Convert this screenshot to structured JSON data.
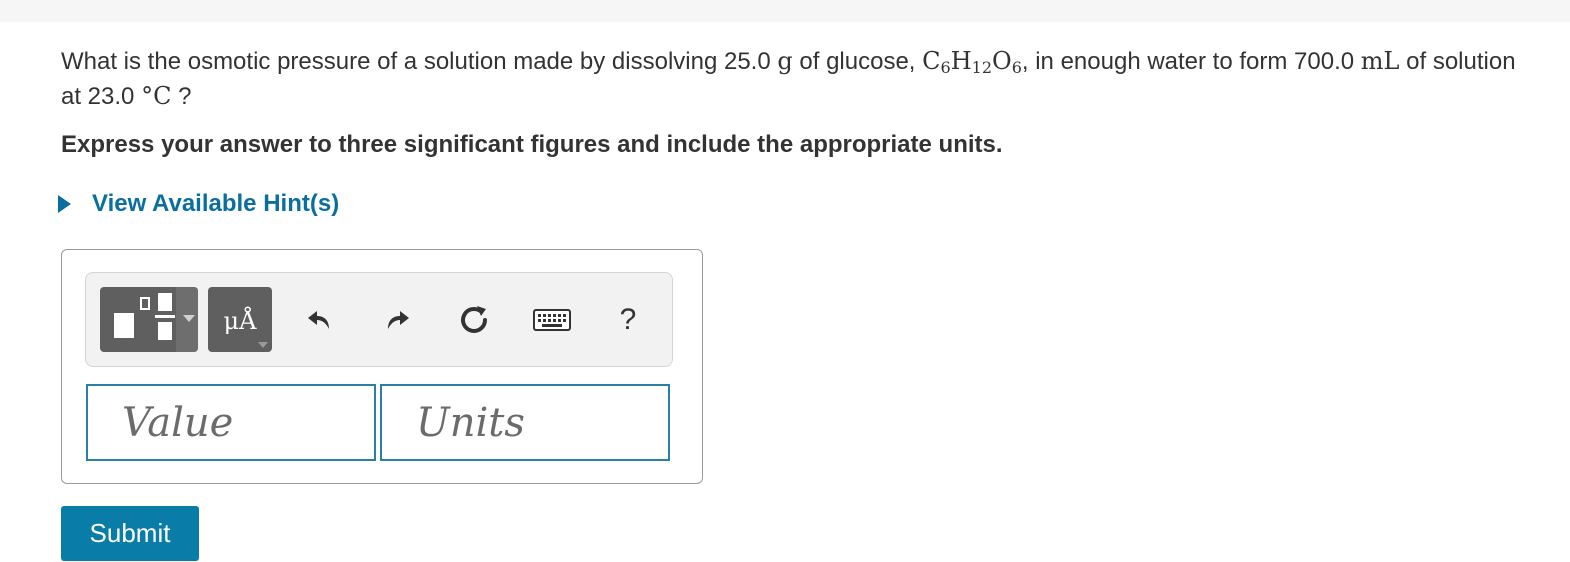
{
  "question": {
    "text_before_mass": "What is the osmotic pressure of a solution made by dissolving 25.0 ",
    "mass_unit": "g",
    "text_before_formula": " of glucose, ",
    "formula": {
      "c": "C",
      "c_sub": "6",
      "h": "H",
      "h_sub": "12",
      "o": "O",
      "o_sub": "6"
    },
    "text_before_volume": ", in enough water to form 700.0 ",
    "volume_unit": "mL",
    "text_before_temp": " of solution at 23.0 ",
    "temp_unit": "°C",
    "text_end": " ?"
  },
  "instruction": "Express your answer to three significant figures and include the appropriate units.",
  "hint": {
    "label": "View Available Hint(s)"
  },
  "toolbar": {
    "units_label": "μÅ",
    "help_label": "?"
  },
  "inputs": {
    "value_placeholder": "Value",
    "units_placeholder": "Units"
  },
  "submit_label": "Submit",
  "colors": {
    "link": "#0a6fa0",
    "submit_bg": "#0a7ca8",
    "field_border": "#2a7fa5",
    "toolbar_button": "#5f5f5f"
  },
  "icons": [
    "template-icon",
    "undo-icon",
    "redo-icon",
    "reset-icon",
    "keyboard-icon",
    "help-icon",
    "caret-right-icon"
  ]
}
